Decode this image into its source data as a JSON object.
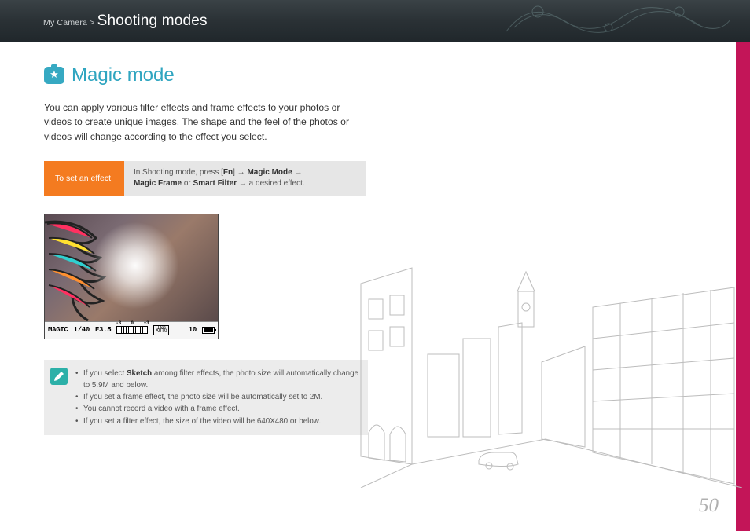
{
  "header": {
    "breadcrumb_prefix": "My Camera >",
    "section": "Shooting modes"
  },
  "title": "Magic mode",
  "intro": "You can apply various filter effects and frame effects to your photos or videos to create unique images. The shape and the feel of the photos or videos will change according to the effect you select.",
  "instruction": {
    "label": "To set an effect,",
    "pre_text": "In Shooting mode, press [",
    "fn": "Fn",
    "post_fn": "] →",
    "bold1": "Magic Mode",
    "arrow1": "→",
    "bold2": "Magic Frame",
    "or": "or",
    "bold3": "Smart Filter",
    "post_text": "→ a desired effect."
  },
  "status_bar": {
    "mode": "MAGIC",
    "shutter": "1/40",
    "aperture": "F3.5",
    "ev_left": "-3",
    "ev_mid": "0",
    "ev_right": "+3",
    "iso_label": "ISO",
    "iso_value": "AUTO",
    "count": "10"
  },
  "notes": [
    {
      "pre": "If you select ",
      "bold": "Sketch",
      "post": " among filter effects, the photo size will automatically change to 5.9M and below."
    },
    {
      "pre": "If you set a frame effect, the photo size will be automatically set to 2M.",
      "bold": "",
      "post": ""
    },
    {
      "pre": "You cannot record a video with a frame effect.",
      "bold": "",
      "post": ""
    },
    {
      "pre": "If you set a filter effect, the size of the video will be 640X480 or below.",
      "bold": "",
      "post": ""
    }
  ],
  "page_number": "50"
}
